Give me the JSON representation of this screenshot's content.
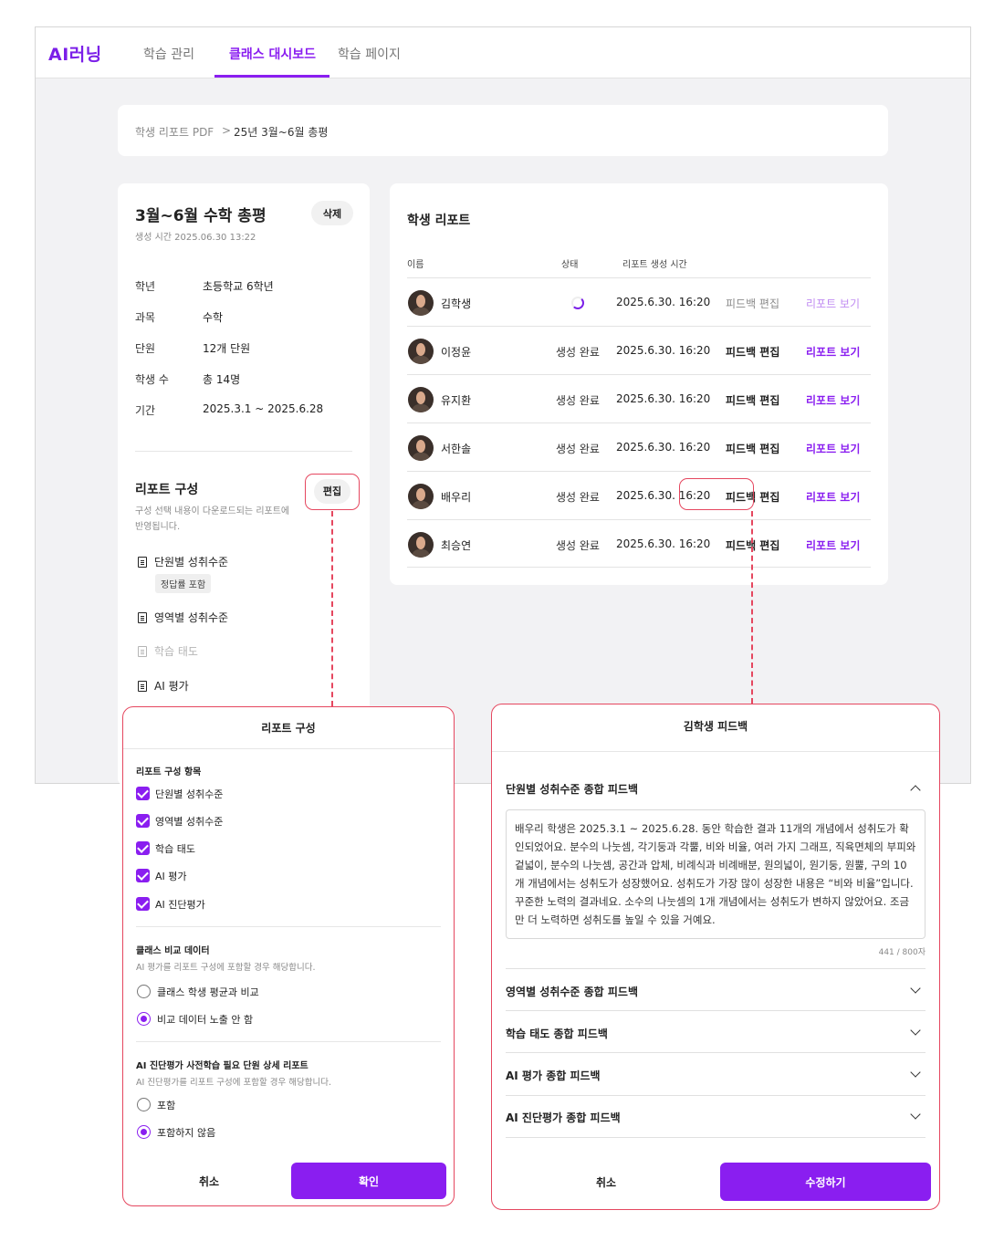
{
  "app": {
    "logo": "AI러닝",
    "brand_color": "#8a1ef0",
    "highlight_color": "#e5475f",
    "nav": [
      {
        "label": "학습 관리",
        "active": false
      },
      {
        "label": "클래스 대시보드",
        "active": true
      },
      {
        "label": "학습 페이지",
        "active": false
      }
    ]
  },
  "breadcrumb": {
    "parent": "학생 리포트 PDF",
    "separator": ">",
    "current": "25년 3월~6월 총평"
  },
  "info": {
    "title": "3월~6월 수학 총평",
    "created": "생성 시간 2025.06.30 13:22",
    "delete_label": "삭제",
    "fields": [
      {
        "label": "학년",
        "value": "초등학교 6학년"
      },
      {
        "label": "과목",
        "value": "수학"
      },
      {
        "label": "단원",
        "value": "12개 단원"
      },
      {
        "label": "학생 수",
        "value": "총 14명"
      },
      {
        "label": "기간",
        "value": "2025.3.1 ~ 2025.6.28"
      }
    ],
    "config_title": "리포트 구성",
    "edit_label": "편집",
    "config_desc": "구성 선택 내용이 다운로드되는 리포트에 반영됩니다.",
    "items": [
      {
        "label": "단원별 성취수준",
        "icon": "document-icon",
        "muted": false
      },
      {
        "label": "영역별 성취수준",
        "icon": "document-icon",
        "muted": false
      },
      {
        "label": "학습 태도",
        "icon": "document-icon",
        "muted": true
      },
      {
        "label": "AI 평가",
        "icon": "document-icon",
        "muted": false
      }
    ],
    "chip": "정답률 포함"
  },
  "report": {
    "title": "학생 리포트",
    "headers": {
      "name": "이름",
      "status": "상태",
      "time": "리포트 생성 시간"
    },
    "feedback_label": "피드백 편집",
    "view_label": "리포트 보기",
    "rows": [
      {
        "name": "김학생",
        "status": "",
        "loading": true,
        "time": "2025.6.30. 16:20"
      },
      {
        "name": "이정윤",
        "status": "생성 완료",
        "loading": false,
        "time": "2025.6.30. 16:20"
      },
      {
        "name": "유지환",
        "status": "생성 완료",
        "loading": false,
        "time": "2025.6.30. 16:20"
      },
      {
        "name": "서한솔",
        "status": "생성 완료",
        "loading": false,
        "time": "2025.6.30. 16:20"
      },
      {
        "name": "배우리",
        "status": "생성 완료",
        "loading": false,
        "time": "2025.6.30. 16:20"
      },
      {
        "name": "최승연",
        "status": "생성 완료",
        "loading": false,
        "time": "2025.6.30. 16:20"
      }
    ]
  },
  "config_modal": {
    "title": "리포트 구성",
    "section1": "리포트 구성 항목",
    "checkboxes": [
      "단원별 성취수준",
      "영역별 성취수준",
      "학습 태도",
      "AI 평가",
      "AI 진단평가"
    ],
    "section2": "클래스 비교 데이터",
    "section2_desc": "AI 평가를 리포트 구성에 포함할 경우 해당합니다.",
    "radios2": [
      {
        "label": "클래스 학생 평균과 비교",
        "on": false
      },
      {
        "label": "비교 데이터 노출 안 함",
        "on": true
      }
    ],
    "section3": "AI 진단평가 사전학습 필요 단원 상세 리포트",
    "section3_desc": "AI 진단평가를 리포트 구성에 포함할 경우 해당합니다.",
    "radios3": [
      {
        "label": "포함",
        "on": false
      },
      {
        "label": "포함하지 않음",
        "on": true
      }
    ],
    "cancel": "취소",
    "confirm": "확인"
  },
  "feedback_modal": {
    "title": "김학생 피드백",
    "open_section": "단원별 성취수준 종합 피드백",
    "text": "배우리 학생은 2025.3.1 ~ 2025.6.28. 동안 학습한 결과 11개의 개념에서 성취도가 확인되었어요. 분수의 나눗셈, 각기둥과 각뿔, 비와 비율, 여러 가지 그래프, 직육면체의 부피와 겉넓이, 분수의 나눗셈, 공간과 압체, 비례식과 비례배분, 원의넓이, 원기둥, 원뿔, 구의 10개 개념에서는 성취도가 성장했어요. 성취도가 가장 많이 성장한 내용은 “비와 비율”입니다. 꾸준한 노력의 결과네요. 소수의 나눗셈의 1개 개념에서는 성취도가 변하지 않았어요. 조금만 더 노력하면 성취도를 높일 수 있을 거예요.",
    "counter": "441 / 800자",
    "sections": [
      "영역별 성취수준 종합 피드백",
      "학습 태도 종합 피드백",
      "AI 평가 종합 피드백",
      "AI 진단평가 종합 피드백"
    ],
    "cancel": "취소",
    "submit": "수정하기"
  }
}
